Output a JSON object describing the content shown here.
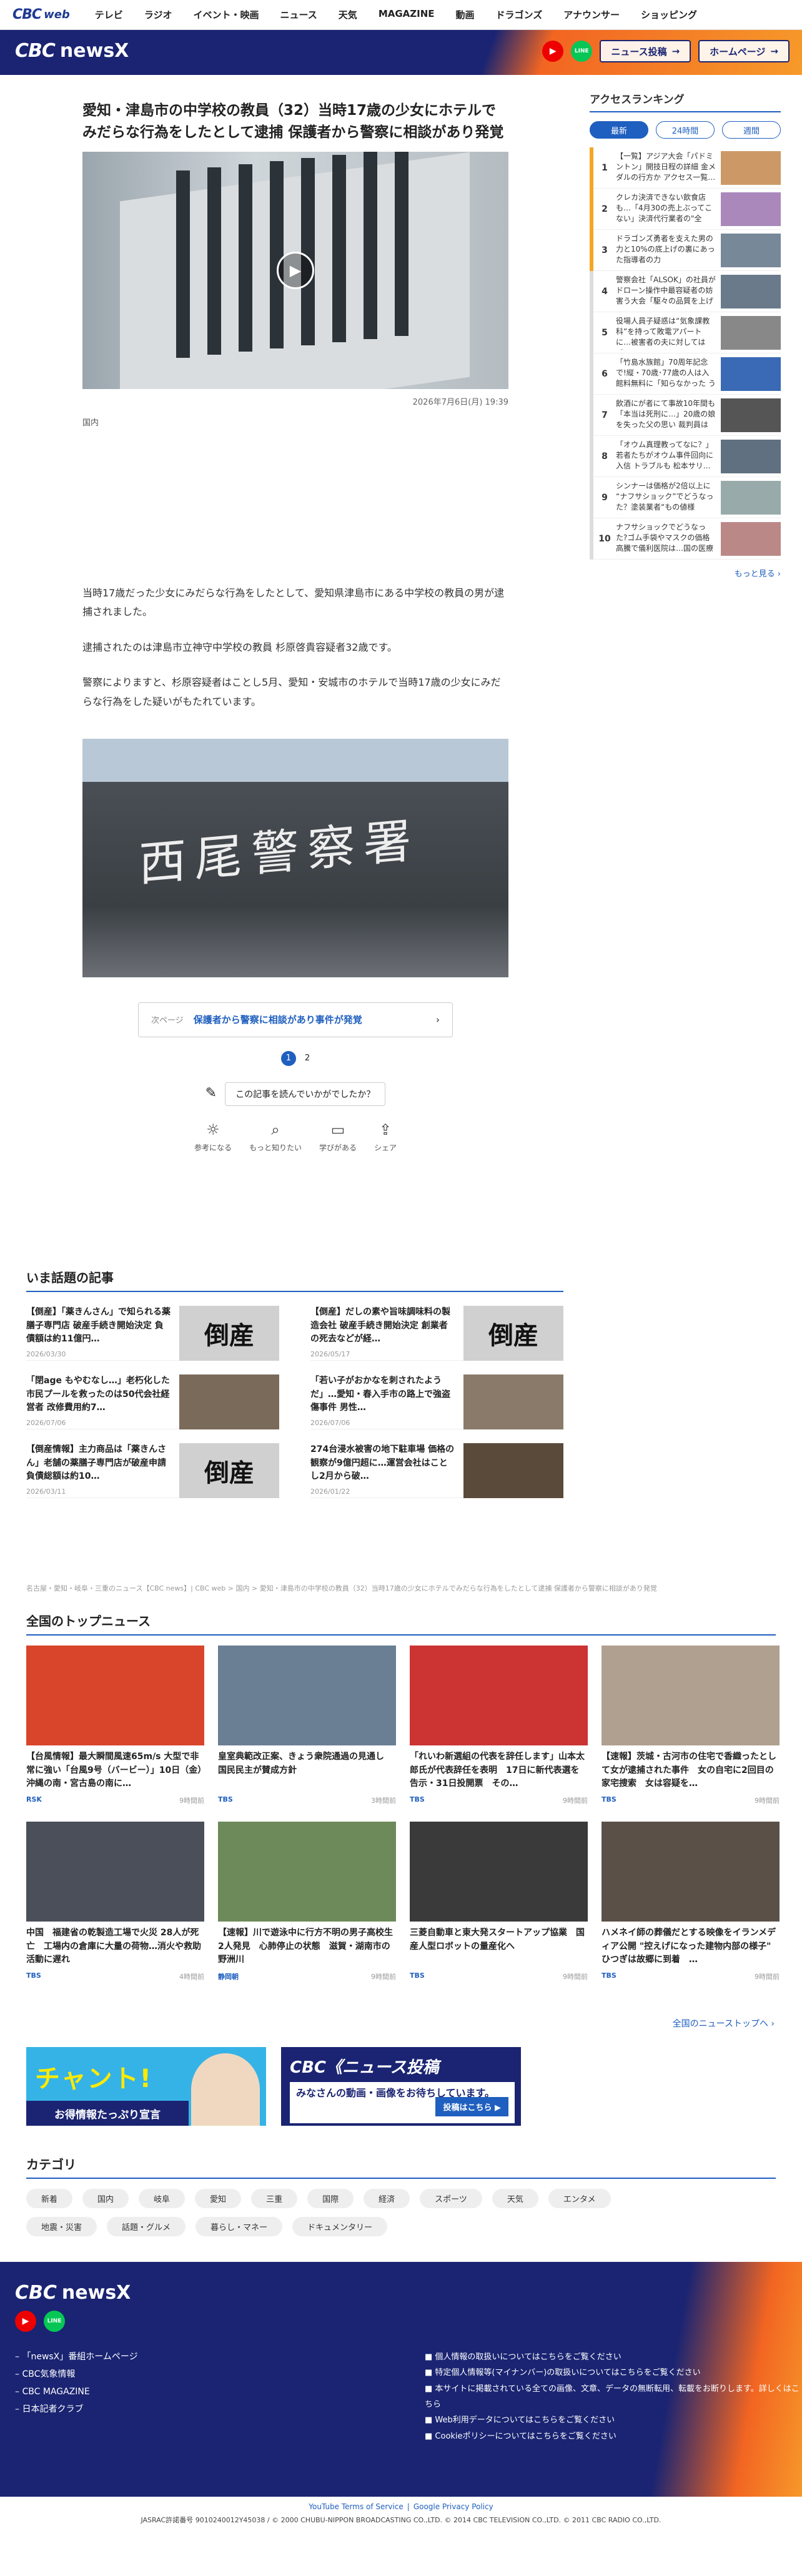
{
  "topnav": {
    "logo_a": "CBC",
    "logo_b": "web",
    "items": [
      "テレビ",
      "ラジオ",
      "イベント・映画",
      "ニュース",
      "天気",
      "MAGAZINE",
      "動画",
      "ドラゴンズ",
      "アナウンサー",
      "ショッピング"
    ]
  },
  "banner": {
    "logo_cbc": "CBC",
    "logo_news": "newsX",
    "yt": "▶",
    "line": "LINE",
    "post": "ニュース投稿",
    "home": "ホームページ"
  },
  "article": {
    "title": "愛知・津島市の中学校の教員（32）当時17歳の少女にホテルでみだらな行為をしたとして逮捕 保護者から警察に相談があり発覚",
    "date": "2026年7月6日(月) 19:39",
    "category": "国内",
    "paragraphs": [
      "当時17歳だった少女にみだらな行為をしたとして、愛知県津島市にある中学校の教員の男が逮捕されました。",
      "逮捕されたのは津島市立神守中学校の教員 杉原啓貴容疑者32歳です。",
      "警察によりますと、杉原容疑者はことし5月、愛知・安城市のホテルで当時17歳の少女にみだらな行為をした疑いがもたれています。"
    ],
    "image2_sign": "西尾警察署",
    "next_label": "次ページ",
    "next_text": "保護者から警察に相談があり事件が発覚",
    "pages": [
      "1",
      "2"
    ],
    "question": "この記事を読んでいかがでしたか？",
    "reactions": [
      "参考になる",
      "もっと知りたい",
      "学びがある",
      "シェア"
    ]
  },
  "ranking": {
    "title": "アクセスランキング",
    "tabs": [
      "最新",
      "24時間",
      "週間"
    ],
    "items": [
      {
        "n": "1",
        "t": "【一覧】アジア大会「パドミントン」開技日程の詳細 金メダルの行方か アクセス一覧…",
        "c": "#f5a623"
      },
      {
        "n": "2",
        "t": "クレカ決済できない飲食店も…「4月30の売上ぶってこない」決済代行業者の\"全休\"中…",
        "c": "#f5a623"
      },
      {
        "n": "3",
        "t": "ドラゴンズ勇者を支えた男の力と10%の底上げの裏にあった指導者の力",
        "c": "#f5a623"
      },
      {
        "n": "4",
        "t": "警察会社「ALSOK」の社員がドローン操作中最容疑者の妨害う大会「駆々の品質を上げて…",
        "c": "#ddd"
      },
      {
        "n": "5",
        "t": "役場人員子疑惑は“気象課教科”を持って敗電アパートに…被害者の夫に対しては「な…",
        "c": "#ddd"
      },
      {
        "n": "6",
        "t": "「竹島水族館」70周年記念で!縦・70歳･77歳の人は入館料無料に「知らなかった うれしい…",
        "c": "#ddd"
      },
      {
        "n": "7",
        "t": "飲酒にが者にて事故10年間も「本当は死刑に…」20歳の娘を失った父の思い 裁判員は破…",
        "c": "#ddd"
      },
      {
        "n": "8",
        "t": "「オウム真理教ってなに？」若者たちがオウム事件回向に入信 トラブルも 松本サリ…",
        "c": "#ddd"
      },
      {
        "n": "9",
        "t": "シンナーは価格が2倍以上に “ナフサショック”でどうなった？塗装業者“もの値様増”で…",
        "c": "#ddd"
      },
      {
        "n": "10",
        "t": "ナフサショックでどうなった?ゴム手袋やマスクの価格高騰で儀利医院は…国の医療機…",
        "c": "#ddd"
      }
    ],
    "more": "もっと見る ›"
  },
  "hot": {
    "title": "いま話題の記事",
    "items": [
      {
        "t": "【倒産】「薬きんさん」で知られる薬膳子専門店 破産手続き開始決定 負債額は約11億円…",
        "d": "2026/03/30",
        "img": "倒産"
      },
      {
        "t": "【倒産】だしの素や旨味調味料の製造会社 破産手続き開始決定 創業者の死去などが経…",
        "d": "2026/05/17",
        "img": "倒産"
      },
      {
        "t": "「閉age もやむなし…」老朽化した市民プールを救ったのは50代会社経営者 改修費用約7…",
        "d": "2026/07/06",
        "img": ""
      },
      {
        "t": "「若い子がおかなを刺されたようだ」…愛知・春入手市の路上で強盗傷事件 男性…",
        "d": "2026/07/06",
        "img": ""
      },
      {
        "t": "【倒産情報】主力商品は「薬きんさん」老舗の薬膳子専門店が破産申請 負債総額は約10…",
        "d": "2026/03/11",
        "img": "倒産"
      },
      {
        "t": "274台浸水被害の地下駐車場 価格の観察が9億円超に…運営会社はことし2月から破…",
        "d": "2026/01/22",
        "img": ""
      }
    ]
  },
  "breadcrumb": "名古屋・愛知・岐阜・三重のニュース【CBC news】| CBC web > 国内 > 愛知・津島市の中学校の教員（32）当時17歳の少女にホテルでみだらな行為をしたとして逮捕 保護者から警察に相談があり発覚",
  "top": {
    "title": "全国のトップニュース",
    "items": [
      {
        "t": "【台風情報】最大瞬間風速65m/s 大型で非常に強い「台風9号（バービー）」10日（金）沖縄の南・宮古島の南に…",
        "s": "RSK",
        "tm": "9時間前"
      },
      {
        "t": "皇室典範改正案、きょう衆院通過の見通し　国民民主が賛成方針",
        "s": "TBS",
        "tm": "3時間前"
      },
      {
        "t": "「れいわ新選組の代表を辞任します」山本太郎氏が代表辞任を表明　17日に新代表選を告示・31日投開票　その…",
        "s": "TBS",
        "tm": "9時間前"
      },
      {
        "t": "【速報】茨城・古河市の住宅で香織ったとして女が逮捕された事件　女の自宅に2回目の家宅捜索　女は容疑を…",
        "s": "TBS",
        "tm": "9時間前"
      },
      {
        "t": "中国　福建省の乾製造工場で火災 28人が死亡　工場内の倉庫に大量の荷物…消火や救助活動に遅れ",
        "s": "TBS",
        "tm": "4時間前"
      },
      {
        "t": "【速報】川で遊泳中に行方不明の男子高校生2人発見　心肺停止の状態　滋賀・湖南市の野洲川",
        "s": "静岡朝",
        "tm": "9時間前"
      },
      {
        "t": "三菱自動車と東大発スタートアップ協業　国産人型ロボットの量産化へ",
        "s": "TBS",
        "tm": "9時間前"
      },
      {
        "t": "ハメネイ師の葬儀だとする映像をイランメディア公開 \"控えげになった建物内部の様子\" ひつぎは故郷に到着　…",
        "s": "TBS",
        "tm": "9時間前"
      }
    ],
    "all": "全国のニューストップへ ›"
  },
  "ads": {
    "chant": "チャント!",
    "chant_sub": "お得情報たっぷり宣言",
    "cbc": "CBC《ニュース投稿",
    "cbc_sub": "みなさんの動画・画像をお待ちしています。",
    "cbc_btn": "投稿はこちら ▶"
  },
  "categories": {
    "title": "カテゴリ",
    "items": [
      "新着",
      "国内",
      "岐阜",
      "愛知",
      "三重",
      "国際",
      "経済",
      "スポーツ",
      "天気",
      "エンタメ",
      "地震・災害",
      "話題・グルメ",
      "暮らし・マネー",
      "ドキュメンタリー"
    ]
  },
  "footer": {
    "logo_cbc": "CBC",
    "logo_news": "newsX",
    "links": [
      "「newsX」番組ホームページ",
      "CBC気象情報",
      "CBC MAGAZINE",
      "日本記者クラブ"
    ],
    "right": [
      "個人情報の取扱いについてはこちらをご覧ください",
      "特定個人情報等(マイナンバー)の取扱いについてはこちらをご覧ください",
      "本サイトに掲載されている全ての画像、文章、データの無断転用、転載をお断りします。詳しくはこちら",
      "Web利用データについてはこちらをご覧ください",
      "Cookieポリシーについてはこちらをご覧ください"
    ],
    "policy": [
      "YouTube Terms of Service",
      "Google Privacy Policy"
    ],
    "copy": "JASRAC許諾番号 9010240012Y45038 / © 2000 CHUBU-NIPPON BROADCASTING CO.,LTD. © 2014 CBC TELEVISION CO.,LTD. © 2011 CBC RADIO CO.,LTD."
  }
}
